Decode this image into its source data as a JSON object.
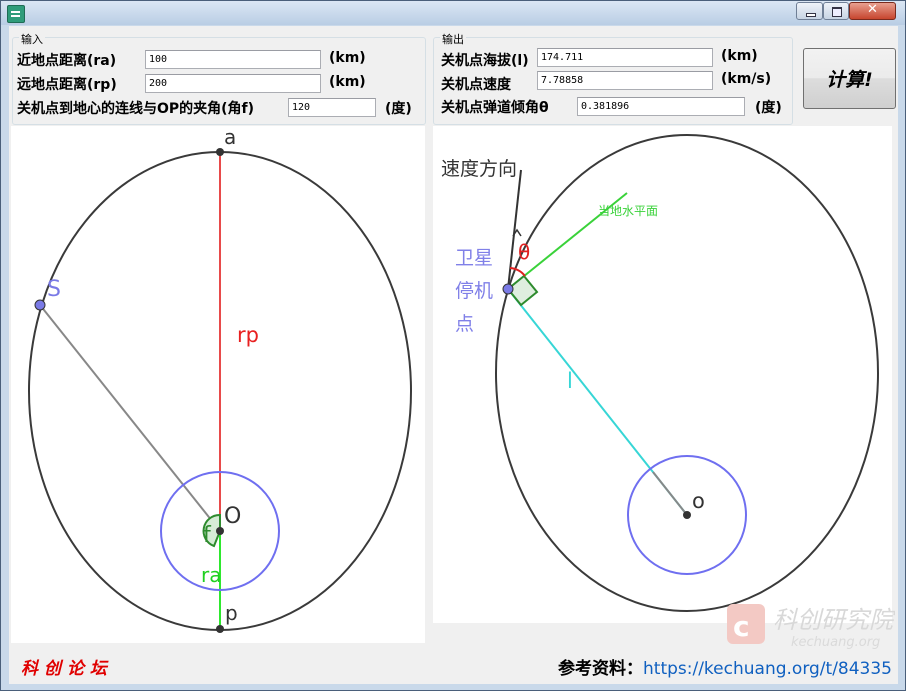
{
  "window": {
    "title": "",
    "close_glyph": "✕"
  },
  "input_group": {
    "title": "输入",
    "ra_label": "近地点距离(ra)",
    "ra_value": "100",
    "ra_unit": "(km)",
    "rp_label": "远地点距离(rp)",
    "rp_value": "200",
    "rp_unit": "(km)",
    "angle_label": "关机点到地心的连线与OP的夹角(角f)",
    "angle_value": "120",
    "angle_unit": "(度)"
  },
  "output_group": {
    "title": "输出",
    "altitude_label": "关机点海拔(l)",
    "altitude_value": "174.711",
    "altitude_unit": "(km)",
    "speed_label": "关机点速度",
    "speed_value": "7.78858",
    "speed_unit": "(km/s)",
    "incl_label": "关机点弹道倾角θ",
    "incl_value": "0.381896",
    "incl_unit": "(度)"
  },
  "calculate_button": {
    "label": "计算!"
  },
  "left_diagram": {
    "label_a": "a",
    "label_s": "S",
    "label_rp": "rp",
    "label_o": "O",
    "label_f": "f",
    "label_ra": "ra",
    "label_p": "p",
    "colors": {
      "orbit": "#3a3a3a",
      "rp": "#e84a4a",
      "ra": "#2ee82e",
      "earth": "#6f6ff0",
      "s_line": "#888888",
      "angle": "#2e8b2e"
    }
  },
  "right_diagram": {
    "label_velocity": "速度方向",
    "label_theta": "θ",
    "label_horizon": "当地水平面",
    "label_satellite_1": "卫星",
    "label_satellite_2": "停机",
    "label_satellite_3": "点",
    "label_l": "l",
    "label_o": "o",
    "colors": {
      "orbit": "#3a3a3a",
      "l_line": "#37d6d6",
      "horizon": "#3ad23a",
      "earth": "#6f6ff0",
      "theta": "#e02020",
      "satellite": "#8080e8"
    }
  },
  "footer": {
    "forum_name": "科 创 论 坛",
    "ref_label": "参考资料：",
    "ref_url": "https://kechuang.org/t/84335",
    "watermark_text": "科创研究院",
    "watermark_domain": "kechuang.org"
  }
}
